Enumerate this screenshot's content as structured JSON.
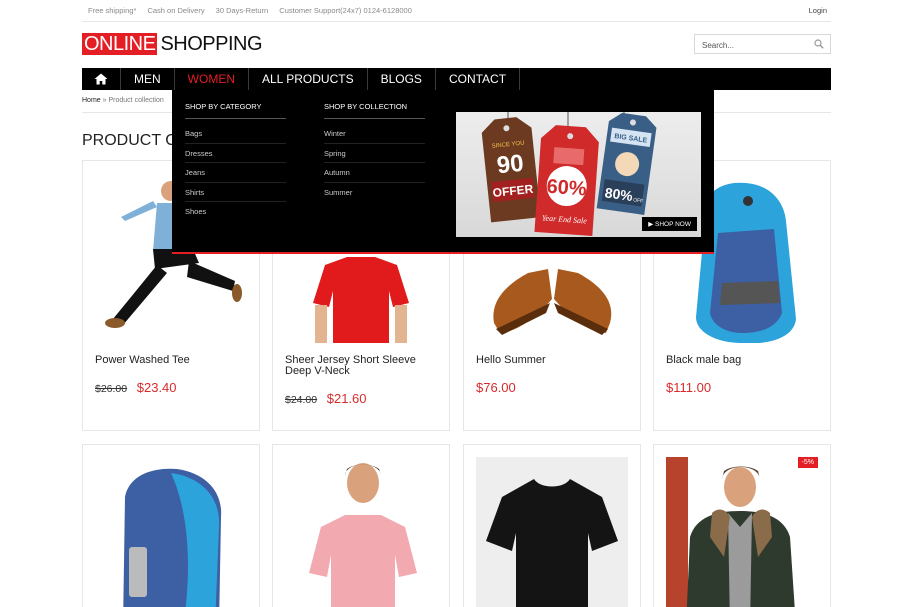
{
  "topbar": {
    "free_shipping": "Free shipping*",
    "cod": "Cash on Delivery",
    "returns": "30 Days-Return",
    "support": "Customer Support(24x7) 0124-6128000",
    "login": "Login"
  },
  "logo": {
    "part1": "ONLINE",
    "part2": "SHOPPING"
  },
  "search": {
    "placeholder": "Search..."
  },
  "nav": {
    "home_icon": "home-icon",
    "items": [
      "MEN",
      "WOMEN",
      "ALL PRODUCTS",
      "BLOGS",
      "CONTACT"
    ],
    "active": "WOMEN"
  },
  "breadcrumb": {
    "home": "Home",
    "separator": "»",
    "current": "Product collection"
  },
  "page_title": "PRODUCT CO",
  "mega_menu": {
    "category_title": "SHOP BY CATEGORY",
    "categories": [
      "Bags",
      "Dresses",
      "Jeans",
      "Shirts",
      "Shoes"
    ],
    "collection_title": "SHOP BY COLLECTION",
    "collections": [
      "Winter",
      "Spring",
      "Autumn",
      "Summer"
    ],
    "banner": {
      "tag1_small": "SINCE YOU",
      "tag1_big": "90",
      "tag1_line": "OFFER",
      "tag2_big": "60%",
      "tag2_line": "Year End Sale",
      "tag3_big": "BIG SALE",
      "tag3_line": "80%",
      "tag3_off": "OFF",
      "shop_now": "SHOP NOW"
    }
  },
  "products": [
    {
      "name": "Power Washed Tee",
      "old_price": "$26.00",
      "price": "$23.40"
    },
    {
      "name": "Sheer Jersey Short Sleeve Deep V-Neck",
      "old_price": "$24.00",
      "price": "$21.60"
    },
    {
      "name": "Hello Summer",
      "old_price": "",
      "price": "$76.00"
    },
    {
      "name": "Black male bag",
      "old_price": "",
      "price": "$111.00"
    }
  ],
  "row2": {
    "badge": "-5%"
  },
  "colors": {
    "accent": "#e31e24",
    "price": "#d92b2b",
    "nav_bg": "#000000"
  }
}
